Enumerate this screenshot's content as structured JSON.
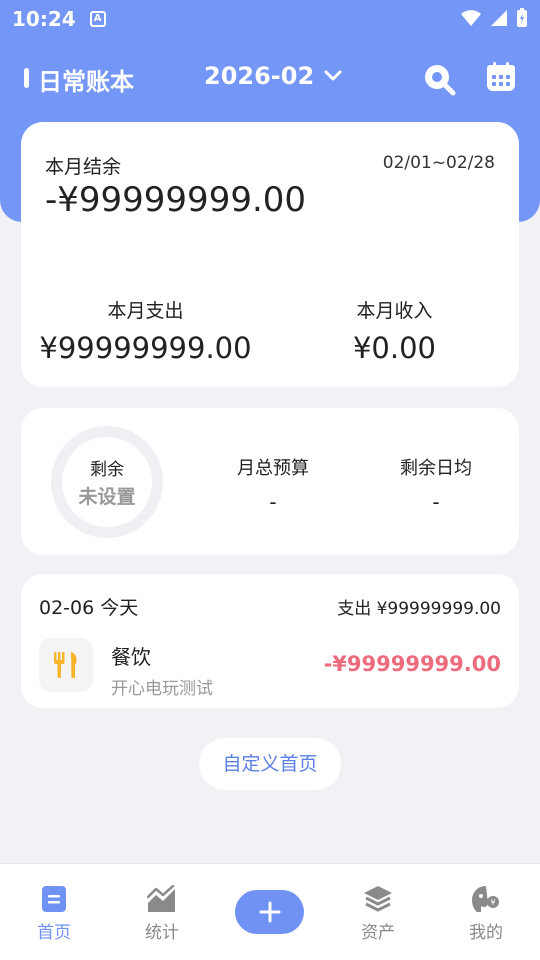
{
  "status_bar": {
    "time": "10:24",
    "notif_badge": "A"
  },
  "app_bar": {
    "book_name": "日常账本",
    "month": "2026-02"
  },
  "balance": {
    "label": "本月结余",
    "date_range": "02/01~02/28",
    "value": "-¥99999999.00",
    "expense_label": "本月支出",
    "expense_value": "¥99999999.00",
    "income_label": "本月收入",
    "income_value": "¥0.00"
  },
  "budget": {
    "ring_label": "剩余",
    "ring_value": "未设置",
    "total_label": "月总预算",
    "total_value": "-",
    "daily_label": "剩余日均",
    "daily_value": "-"
  },
  "day_group": {
    "date": "02-06 今天",
    "total": "支出 ¥99999999.00",
    "transactions": [
      {
        "category": "餐饮",
        "note": "开心电玩测试",
        "amount": "-¥99999999.00",
        "icon": "utensils-icon"
      }
    ]
  },
  "custom_home_label": "自定义首页",
  "nav": {
    "home": "首页",
    "stats": "统计",
    "assets": "资产",
    "mine": "我的"
  },
  "colors": {
    "accent": "#7396f7",
    "expense": "#ec6c7e",
    "icon_yellow": "#f6b42a"
  }
}
